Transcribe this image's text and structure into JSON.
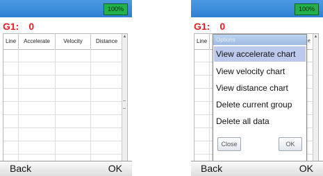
{
  "battery": "100%",
  "group": {
    "label": "G1:",
    "value": "0"
  },
  "table": {
    "headers": [
      "Line",
      "Accelerate",
      "Velocity",
      "Distance"
    ],
    "row_count": 10
  },
  "softkeys": {
    "left": "Back",
    "right": "OK"
  },
  "dialog": {
    "title": "Options",
    "options": [
      "View accelerate chart",
      "View velocity chart",
      "View distance chart",
      "Delete current group",
      "Delete all data"
    ],
    "close_label": "Close",
    "ok_label": "OK",
    "background_header_tail": "e"
  }
}
